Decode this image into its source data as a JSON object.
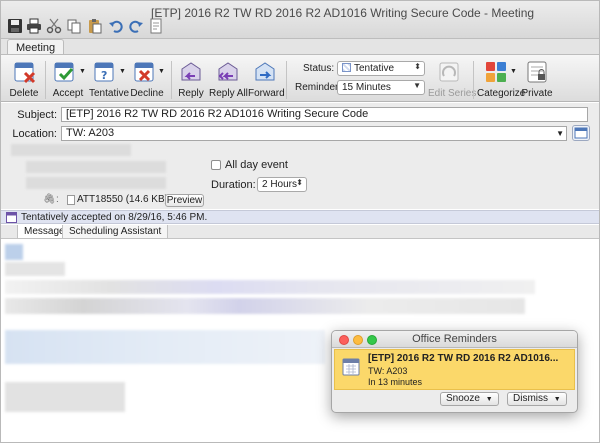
{
  "window": {
    "title": "[ETP] 2016 R2 TW RD 2016 R2 AD1016 Writing Secure Code - Meeting"
  },
  "quick_access": [
    "save-icon",
    "print-icon",
    "cut-icon",
    "copy-icon",
    "paste-icon",
    "undo-icon",
    "redo-icon",
    "new-item-icon"
  ],
  "ribbon": {
    "tab": "Meeting",
    "buttons": {
      "delete": "Delete",
      "accept": "Accept",
      "tentative": "Tentative",
      "decline": "Decline",
      "reply": "Reply",
      "reply_all": "Reply All",
      "forward": "Forward",
      "edit_series": "Edit Series",
      "categorize": "Categorize",
      "private": "Private"
    },
    "status_label": "Status:",
    "status_value": "Tentative",
    "reminder_label": "Reminder:",
    "reminder_value": "15 Minutes"
  },
  "form": {
    "subject_label": "Subject:",
    "subject_value": "[ETP] 2016 R2 TW RD 2016 R2 AD1016 Writing Secure Code",
    "location_label": "Location:",
    "location_value": "TW: A203",
    "all_day_label": "All day event",
    "duration_label": "Duration:",
    "duration_value": "2 Hours",
    "attachment_name": "ATT18550 (14.6 KB)",
    "preview_label": "Preview"
  },
  "info_bar": {
    "text": "Tentatively accepted on 8/29/16, 5:46 PM."
  },
  "body_tabs": {
    "message": "Message",
    "scheduling": "Scheduling Assistant"
  },
  "reminder_popup": {
    "title": "Office Reminders",
    "subject": "[ETP] 2016 R2 TW RD 2016 R2 AD1016...",
    "location": "TW: A203",
    "due": "In 13 minutes",
    "snooze": "Snooze",
    "dismiss": "Dismiss"
  },
  "colors": {
    "reminder_highlight": "#fbd86a",
    "info_bar": "#dfe3f1",
    "close_dot": "#fc605c",
    "minimize_dot": "#fdbc40",
    "zoom_dot": "#34c84a"
  }
}
